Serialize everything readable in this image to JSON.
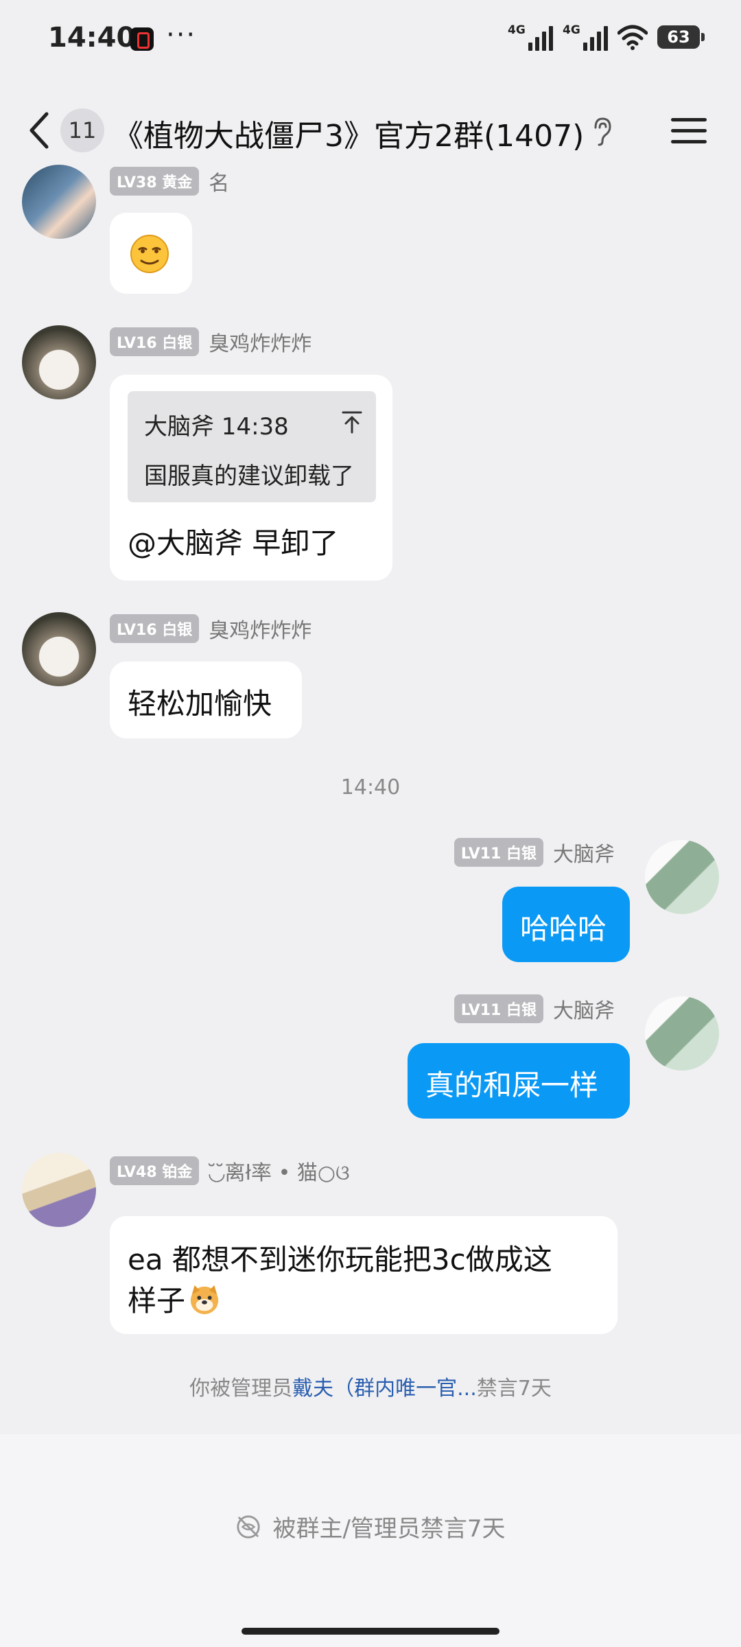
{
  "status_bar": {
    "time": "14:40",
    "more": "···",
    "signal_1": "4G",
    "signal_2": "4G",
    "battery": "63"
  },
  "nav": {
    "unread_count": "11",
    "title": "《植物大战僵尸3》官方2群(1407)"
  },
  "messages": [
    {
      "level": "LV38 黄金",
      "nick": "名",
      "content": "emoji-smile-icon"
    },
    {
      "level": "LV16 白银",
      "nick": "臭鸡炸炸炸",
      "quote_author_time": "大脑斧 14:38",
      "quote_text": "国服真的建议卸载了",
      "text": "@大脑斧 早卸了"
    },
    {
      "level": "LV16 白银",
      "nick": "臭鸡炸炸炸",
      "text": "轻松加愉快"
    },
    {
      "time_separator": "14:40"
    },
    {
      "level": "LV11 白银",
      "nick": "大脑斧",
      "text": "哈哈哈",
      "outgoing": true
    },
    {
      "level": "LV11 白银",
      "nick": "大脑斧",
      "text": "真的和屎一样",
      "outgoing": true
    },
    {
      "level": "LV48 铂金",
      "nick": "◟̆◞̆离ł率 • 猫○ଓ",
      "text_line1": "ea 都想不到迷你玩能把3c做成这",
      "text_line2": "样子",
      "emoji": "doge-icon"
    }
  ],
  "system_msg": {
    "prefix": "你被管理员",
    "admin": "戴夫（群内唯一官...",
    "suffix": "禁言7天"
  },
  "muted_bar": {
    "text": "被群主/管理员禁言7天"
  },
  "colors": {
    "outgoing_bubble": "#0a99f5",
    "level_badge": "#b9b9bd",
    "admin_link": "#2a5fb0"
  }
}
